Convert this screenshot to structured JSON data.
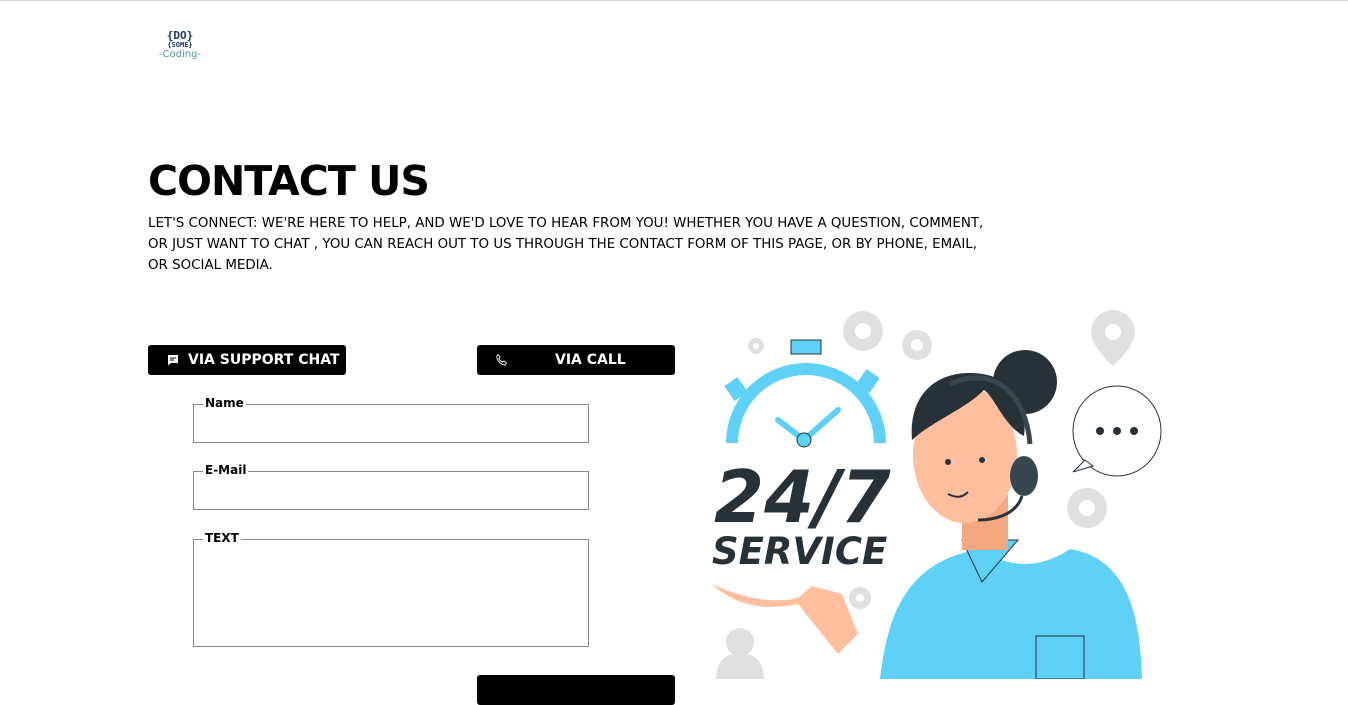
{
  "logo": {
    "line1": "{DO}",
    "line2": "{SOME}",
    "line3": "-Coding-"
  },
  "page": {
    "title": "CONTACT US",
    "intro": "LET'S CONNECT: WE'RE HERE TO HELP, AND WE'D LOVE TO HEAR FROM YOU! WHETHER YOU HAVE A QUESTION, COMMENT, OR JUST WANT TO CHAT , YOU CAN REACH OUT TO US THROUGH THE CONTACT FORM OF THIS PAGE, OR BY PHONE, EMAIL, OR SOCIAL MEDIA."
  },
  "buttons": {
    "chat": "VIA SUPPORT CHAT",
    "call": "VIA CALL",
    "chat_icon": "chat-icon",
    "call_icon": "phone-icon"
  },
  "form": {
    "name_label": "Name",
    "email_label": "E-Mail",
    "text_label": "TEXT"
  },
  "illustration": {
    "big_text": "24/7",
    "sub_text": "SERVICE"
  },
  "colors": {
    "accent": "#5fd1f7",
    "dark": "#263238",
    "button": "#000000"
  }
}
